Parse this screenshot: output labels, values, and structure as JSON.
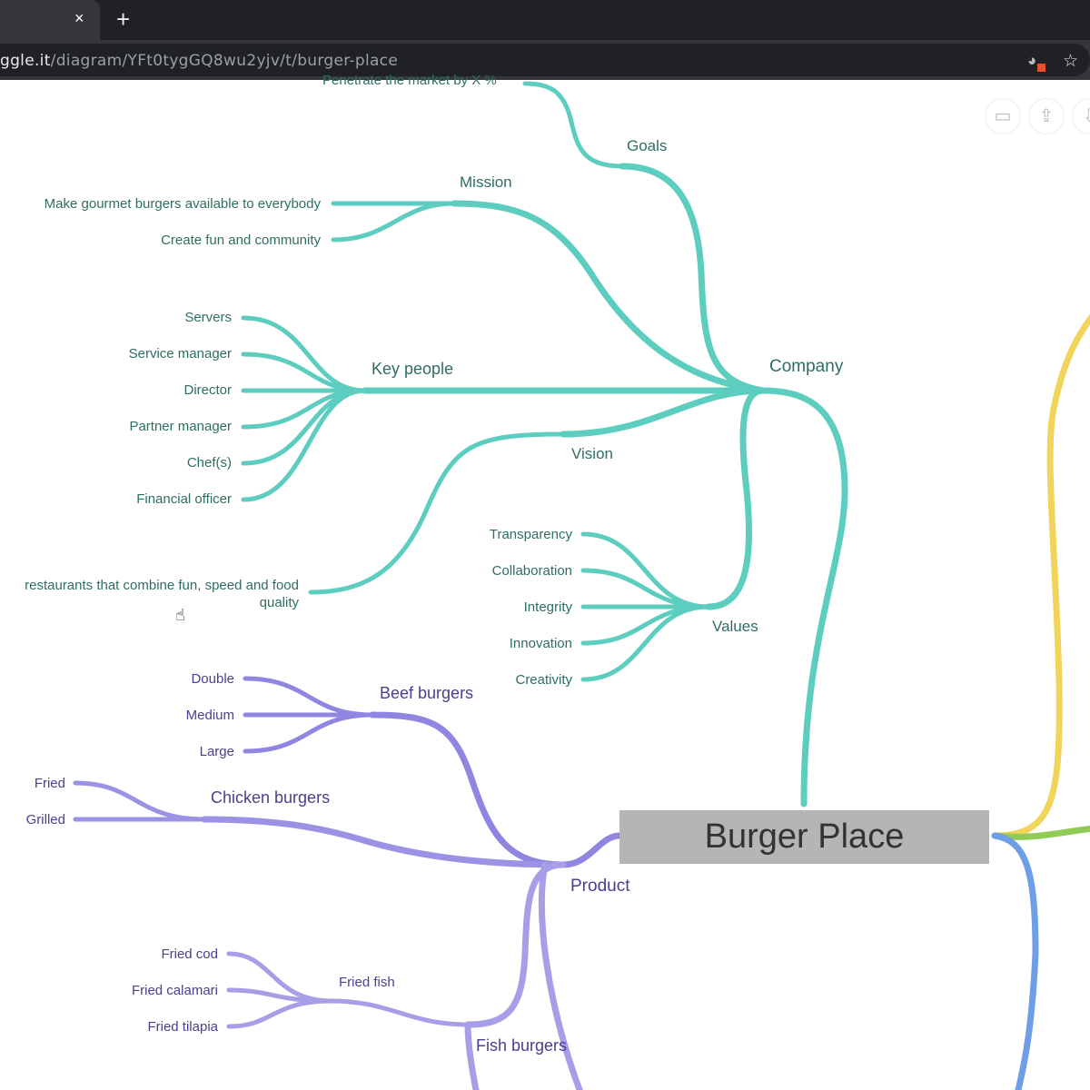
{
  "browser": {
    "close_tab": "×",
    "new_tab": "+",
    "url_host": "ggle.it",
    "url_path": "/diagram/YFt0tygGQ8wu2yjv/t/burger-place",
    "extension_icon": "cookie-blocked-icon",
    "bookmark_icon": "☆"
  },
  "toolbar": {
    "present": "presentation-icon",
    "share": "share-icon",
    "download": "download-icon"
  },
  "root": "Burger Place",
  "company": {
    "label": "Company",
    "goals": {
      "label": "Goals",
      "children": [
        "Penetrate the market by X %"
      ]
    },
    "mission": {
      "label": "Mission",
      "children": [
        "Make gourmet burgers available to everybody",
        "Create fun and community"
      ]
    },
    "key_people": {
      "label": "Key people",
      "children": [
        "Servers",
        "Service manager",
        "Director",
        "Partner manager",
        "Chef(s)",
        "Financial officer"
      ]
    },
    "vision": {
      "label": "Vision",
      "children": [
        "restaurants that combine fun, speed and food quality"
      ]
    },
    "values": {
      "label": "Values",
      "children": [
        "Transparency",
        "Collaboration",
        "Integrity",
        "Innovation",
        "Creativity"
      ]
    }
  },
  "product": {
    "label": "Product",
    "beef": {
      "label": "Beef burgers",
      "children": [
        "Double",
        "Medium",
        "Large"
      ]
    },
    "chicken": {
      "label": "Chicken burgers",
      "children": [
        "Fried",
        "Grilled"
      ]
    },
    "fish": {
      "label": "Fish burgers",
      "fried_fish": {
        "label": "Fried fish",
        "children": [
          "Fried cod",
          "Fried calamari",
          "Fried tilapia"
        ]
      }
    }
  },
  "colors": {
    "company": "#5ccdbf",
    "product": "#8e86e0",
    "product_light": "#a79ee8",
    "yellow": "#f0d55a",
    "green": "#8fcb55",
    "blue": "#6e9ee6",
    "root": "#b5b5b5"
  }
}
